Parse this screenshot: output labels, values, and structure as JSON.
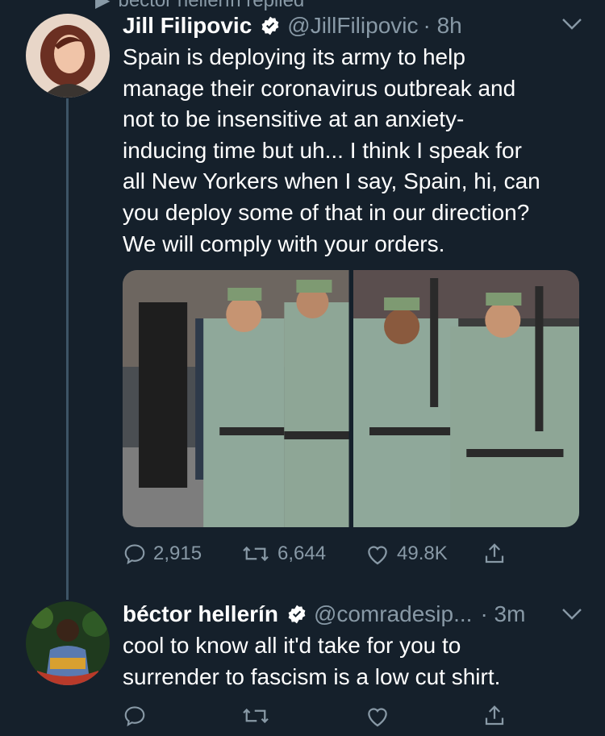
{
  "banner": {
    "text": "béctor hellerín replied"
  },
  "tweet1": {
    "display_name": "Jill Filipovic",
    "handle": "@JillFilipovic",
    "time": "· 8h",
    "text": "Spain is deploying its army to help\nmanage their coronavirus outbreak and\nnot to be insensitive at an anxiety-\ninducing time but uh... I think I speak for\nall New Yorkers when I say, Spain, hi, can\nyou deploy some of that in our direction?\nWe will comply with your orders.",
    "replies": "2,915",
    "retweets": "6,644",
    "likes": "49.8K"
  },
  "tweet2": {
    "display_name": "béctor hellerín",
    "handle": "@comradesip...",
    "time": "· 3m",
    "text": "cool to know all it'd take for you to\nsurrender to fascism is a low cut shirt.",
    "replies": "",
    "retweets": "",
    "likes": ""
  },
  "colors": {
    "background": "#15202b",
    "secondary_text": "#8899a6",
    "thread_line": "#3d5466",
    "uniform": "#8fa89a"
  },
  "icons": [
    "verified-badge-icon",
    "chevron-down-icon",
    "reply-icon",
    "retweet-icon",
    "like-icon",
    "share-icon"
  ]
}
